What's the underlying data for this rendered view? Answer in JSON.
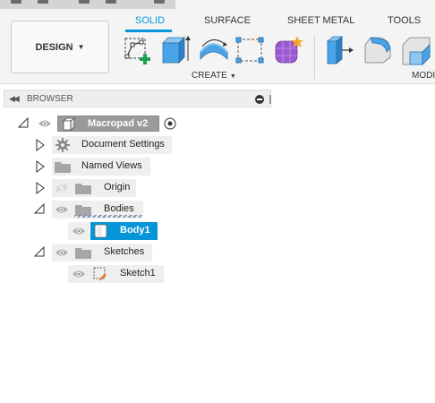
{
  "toolbar": {
    "design_label": "DESIGN",
    "tabs": [
      {
        "label": "SOLID",
        "active": true
      },
      {
        "label": "SURFACE",
        "active": false
      },
      {
        "label": "SHEET METAL",
        "active": false
      },
      {
        "label": "TOOLS",
        "active": false
      }
    ],
    "create_group_label": "CREATE",
    "modify_group_label": "MODI",
    "create_tools": [
      "create-sketch-icon",
      "extrude-icon",
      "revolve-icon",
      "sweep-icon",
      "form-icon"
    ],
    "modify_tools": [
      "press-pull-icon",
      "fillet-icon",
      "chamfer-icon"
    ],
    "accent_color": "#0696d7"
  },
  "browser": {
    "title": "BROWSER",
    "root": {
      "label": "Macropad v2"
    },
    "nodes": [
      {
        "label": "Document Settings",
        "icon": "gear-icon"
      },
      {
        "label": "Named Views",
        "icon": "folder-icon"
      },
      {
        "label": "Origin",
        "icon": "folder-icon",
        "visible": false
      },
      {
        "label": "Bodies",
        "icon": "folder-icon",
        "expanded": true
      },
      {
        "label": "Body1",
        "icon": "body-icon",
        "selected": true
      },
      {
        "label": "Sketches",
        "icon": "folder-icon",
        "expanded": true
      },
      {
        "label": "Sketch1",
        "icon": "sketch-icon"
      }
    ],
    "selection_color": "#0696d7"
  }
}
